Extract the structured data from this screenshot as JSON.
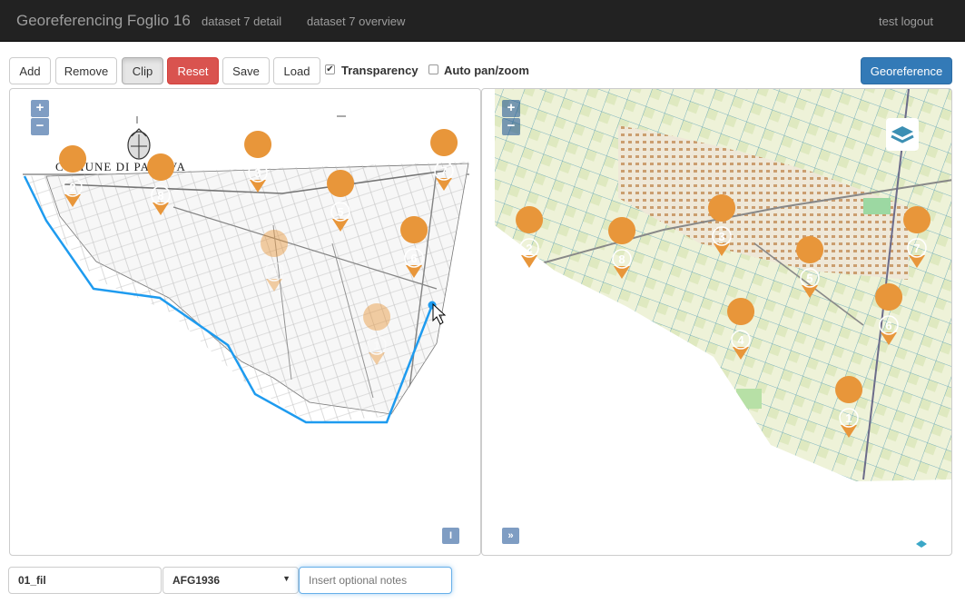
{
  "navbar": {
    "brand": "Georeferencing Foglio 16",
    "links": [
      "dataset 7 detail",
      "dataset 7 overview"
    ],
    "user": "test logout"
  },
  "toolbar": {
    "add": "Add",
    "remove": "Remove",
    "clip": "Clip",
    "reset": "Reset",
    "save": "Save",
    "load": "Load",
    "transparency_label": "Transparency",
    "transparency_checked": true,
    "autopan_label": "Auto pan/zoom",
    "autopan_checked": false,
    "georeference": "Georeference"
  },
  "left_map": {
    "zoom_in": "+",
    "zoom_out": "−",
    "map_title": "COMUNE DI PADOVA",
    "corner_button": "I",
    "markers": [
      "2",
      "8",
      "3",
      "5",
      "7",
      "4",
      "6",
      "1"
    ]
  },
  "right_map": {
    "zoom_in": "+",
    "zoom_out": "−",
    "corner_button": "»",
    "markers": [
      "2",
      "8",
      "3",
      "5",
      "7",
      "4",
      "6",
      "1"
    ]
  },
  "form": {
    "name_value": "01_fil",
    "srs_value": "AFG1936",
    "notes_placeholder": "Insert optional notes"
  },
  "colors": {
    "marker": "#e8963a",
    "clip_line": "#2196f3",
    "navbar": "#222222",
    "danger": "#d9534f",
    "primary": "#337ab7"
  }
}
